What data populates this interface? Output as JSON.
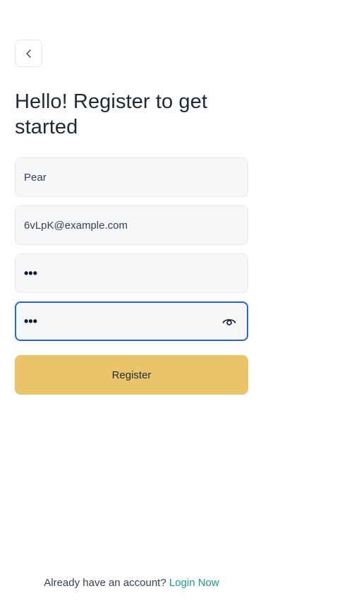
{
  "header": {
    "back_icon": "chevron-left-icon",
    "title": "Hello! Register to get started"
  },
  "form": {
    "username": {
      "value": "Pear"
    },
    "email": {
      "value": "6vLpK@example.com"
    },
    "password": {
      "value": "•••"
    },
    "confirm_password": {
      "value": "•••",
      "toggle_icon": "eye-icon",
      "focused": true
    },
    "register_label": "Register"
  },
  "footer": {
    "prompt": "Already have an account? ",
    "link_label": "Login Now"
  },
  "colors": {
    "accent_button": "#e9c46a",
    "focus_border": "#2563eb",
    "link": "#1f9a8a"
  }
}
